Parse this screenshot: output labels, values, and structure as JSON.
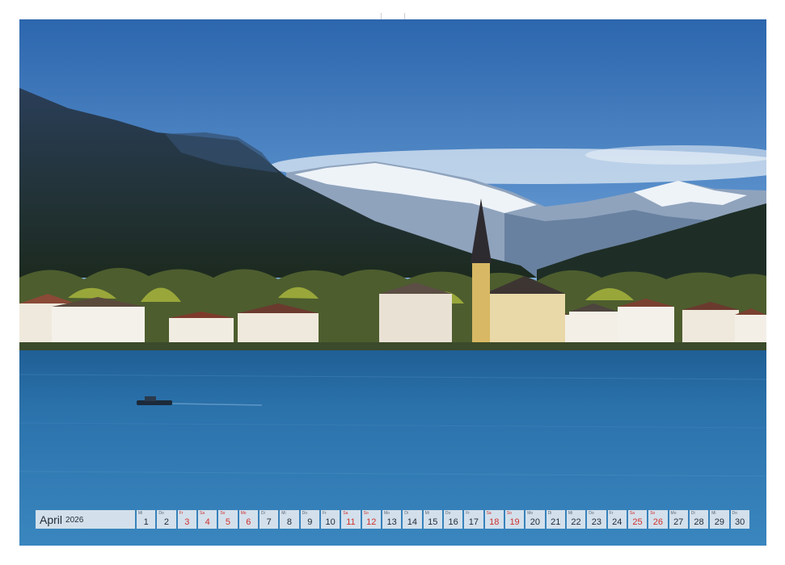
{
  "calendar": {
    "month": "April",
    "year": "2026",
    "days": [
      {
        "wd": "Mi",
        "num": "1",
        "red": false
      },
      {
        "wd": "Do",
        "num": "2",
        "red": false
      },
      {
        "wd": "Fr",
        "num": "3",
        "red": true
      },
      {
        "wd": "Sa",
        "num": "4",
        "red": true
      },
      {
        "wd": "So",
        "num": "5",
        "red": true
      },
      {
        "wd": "Mo",
        "num": "6",
        "red": true
      },
      {
        "wd": "Di",
        "num": "7",
        "red": false
      },
      {
        "wd": "Mi",
        "num": "8",
        "red": false
      },
      {
        "wd": "Do",
        "num": "9",
        "red": false
      },
      {
        "wd": "Fr",
        "num": "10",
        "red": false
      },
      {
        "wd": "Sa",
        "num": "11",
        "red": true
      },
      {
        "wd": "So",
        "num": "12",
        "red": true
      },
      {
        "wd": "Mo",
        "num": "13",
        "red": false
      },
      {
        "wd": "Di",
        "num": "14",
        "red": false
      },
      {
        "wd": "Mi",
        "num": "15",
        "red": false
      },
      {
        "wd": "Do",
        "num": "16",
        "red": false
      },
      {
        "wd": "Fr",
        "num": "17",
        "red": false
      },
      {
        "wd": "Sa",
        "num": "18",
        "red": true
      },
      {
        "wd": "So",
        "num": "19",
        "red": true
      },
      {
        "wd": "Mo",
        "num": "20",
        "red": false
      },
      {
        "wd": "Di",
        "num": "21",
        "red": false
      },
      {
        "wd": "Mi",
        "num": "22",
        "red": false
      },
      {
        "wd": "Do",
        "num": "23",
        "red": false
      },
      {
        "wd": "Fr",
        "num": "24",
        "red": false
      },
      {
        "wd": "Sa",
        "num": "25",
        "red": true
      },
      {
        "wd": "So",
        "num": "26",
        "red": true
      },
      {
        "wd": "Mo",
        "num": "27",
        "red": false
      },
      {
        "wd": "Di",
        "num": "28",
        "red": false
      },
      {
        "wd": "Mi",
        "num": "29",
        "red": false
      },
      {
        "wd": "Do",
        "num": "30",
        "red": false
      }
    ]
  },
  "colors": {
    "sky_top": "#2f6db3",
    "sky_bottom": "#8fb6df",
    "lake": "#2a6fa6",
    "holiday_red": "#d0312d"
  }
}
